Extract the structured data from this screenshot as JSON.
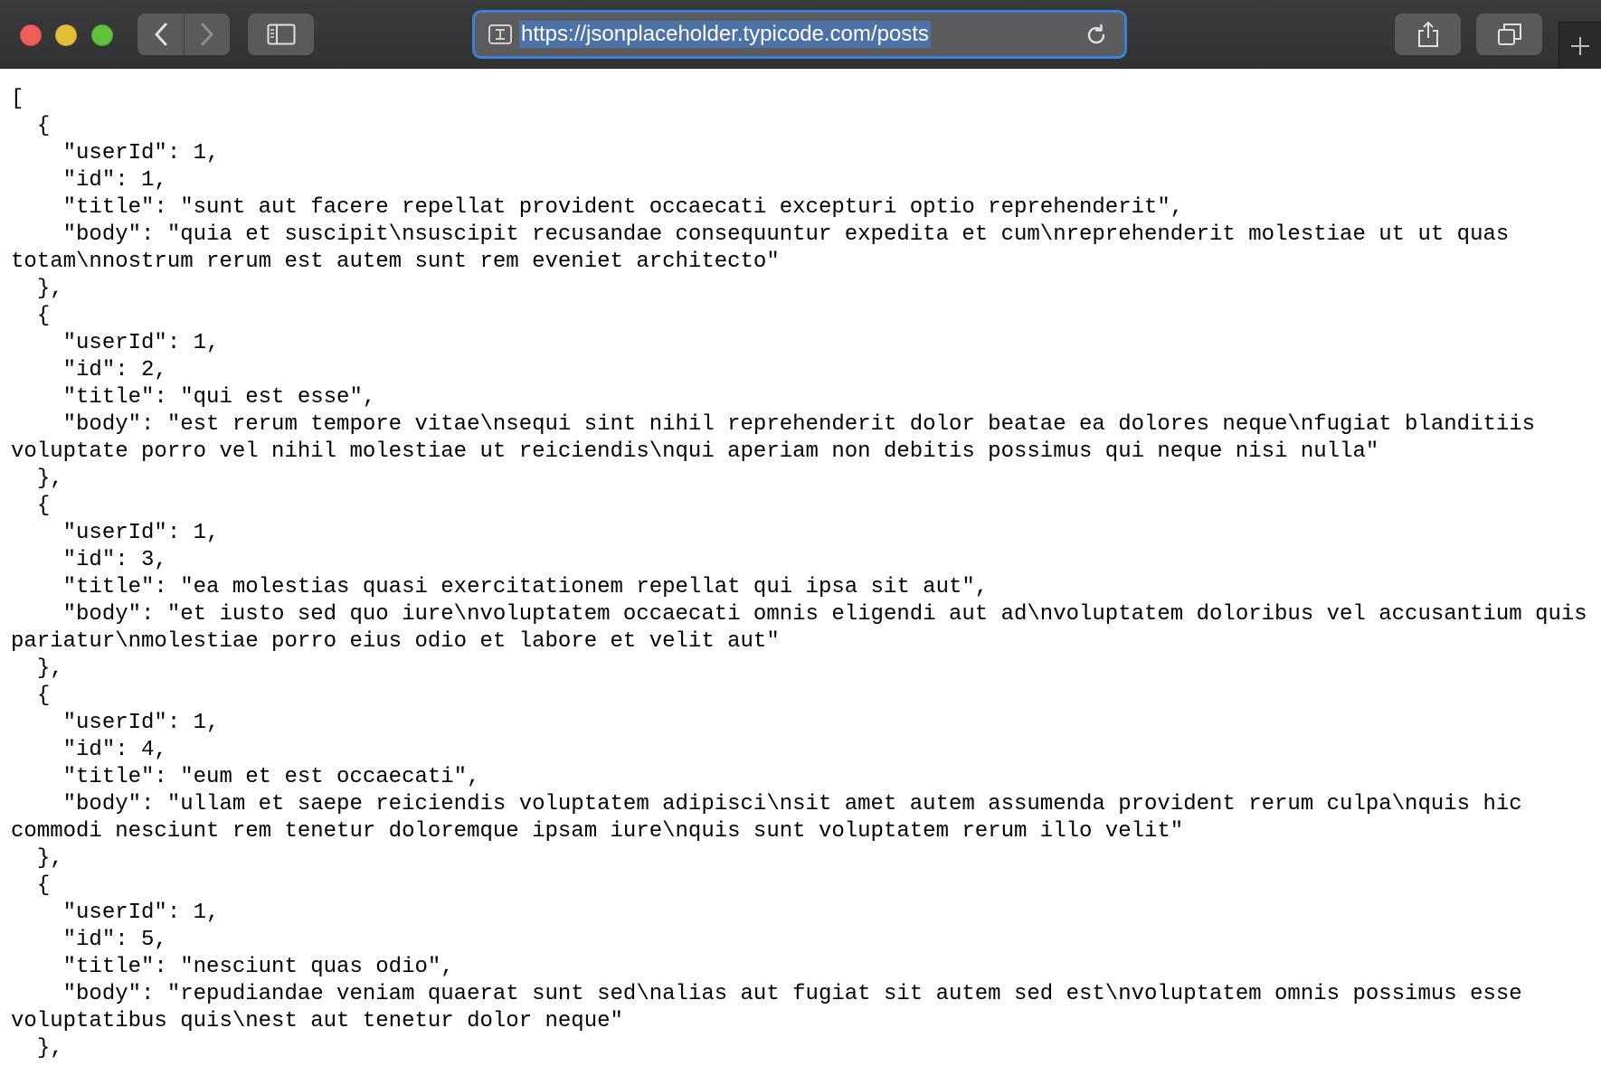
{
  "browser": {
    "url": "https://jsonplaceholder.typicode.com/posts",
    "icons": {
      "back": "chevron-left-icon",
      "forward": "chevron-right-icon",
      "sidebar": "sidebar-icon",
      "site": "reader-icon",
      "reload": "reload-icon",
      "share": "share-icon",
      "tabs": "tab-overview-icon",
      "new_tab": "plus-icon"
    },
    "colors": {
      "toolbar": "#3b3b3d",
      "url_focus_ring": "#3a7fd8",
      "url_selection": "#4d72a8"
    }
  },
  "json_lines": [
    "[",
    "  {",
    "    \"userId\": 1,",
    "    \"id\": 1,",
    "    \"title\": \"sunt aut facere repellat provident occaecati excepturi optio reprehenderit\",",
    "    \"body\": \"quia et suscipit\\nsuscipit recusandae consequuntur expedita et cum\\nreprehenderit molestiae ut ut quas totam\\nnostrum rerum est autem sunt rem eveniet architecto\"",
    "  },",
    "  {",
    "    \"userId\": 1,",
    "    \"id\": 2,",
    "    \"title\": \"qui est esse\",",
    "    \"body\": \"est rerum tempore vitae\\nsequi sint nihil reprehenderit dolor beatae ea dolores neque\\nfugiat blanditiis voluptate porro vel nihil molestiae ut reiciendis\\nqui aperiam non debitis possimus qui neque nisi nulla\"",
    "  },",
    "  {",
    "    \"userId\": 1,",
    "    \"id\": 3,",
    "    \"title\": \"ea molestias quasi exercitationem repellat qui ipsa sit aut\",",
    "    \"body\": \"et iusto sed quo iure\\nvoluptatem occaecati omnis eligendi aut ad\\nvoluptatem doloribus vel accusantium quis pariatur\\nmolestiae porro eius odio et labore et velit aut\"",
    "  },",
    "  {",
    "    \"userId\": 1,",
    "    \"id\": 4,",
    "    \"title\": \"eum et est occaecati\",",
    "    \"body\": \"ullam et saepe reiciendis voluptatem adipisci\\nsit amet autem assumenda provident rerum culpa\\nquis hic commodi nesciunt rem tenetur doloremque ipsam iure\\nquis sunt voluptatem rerum illo velit\"",
    "  },",
    "  {",
    "    \"userId\": 1,",
    "    \"id\": 5,",
    "    \"title\": \"nesciunt quas odio\",",
    "    \"body\": \"repudiandae veniam quaerat sunt sed\\nalias aut fugiat sit autem sed est\\nvoluptatem omnis possimus esse voluptatibus quis\\nest aut tenetur dolor neque\"",
    "  },"
  ]
}
